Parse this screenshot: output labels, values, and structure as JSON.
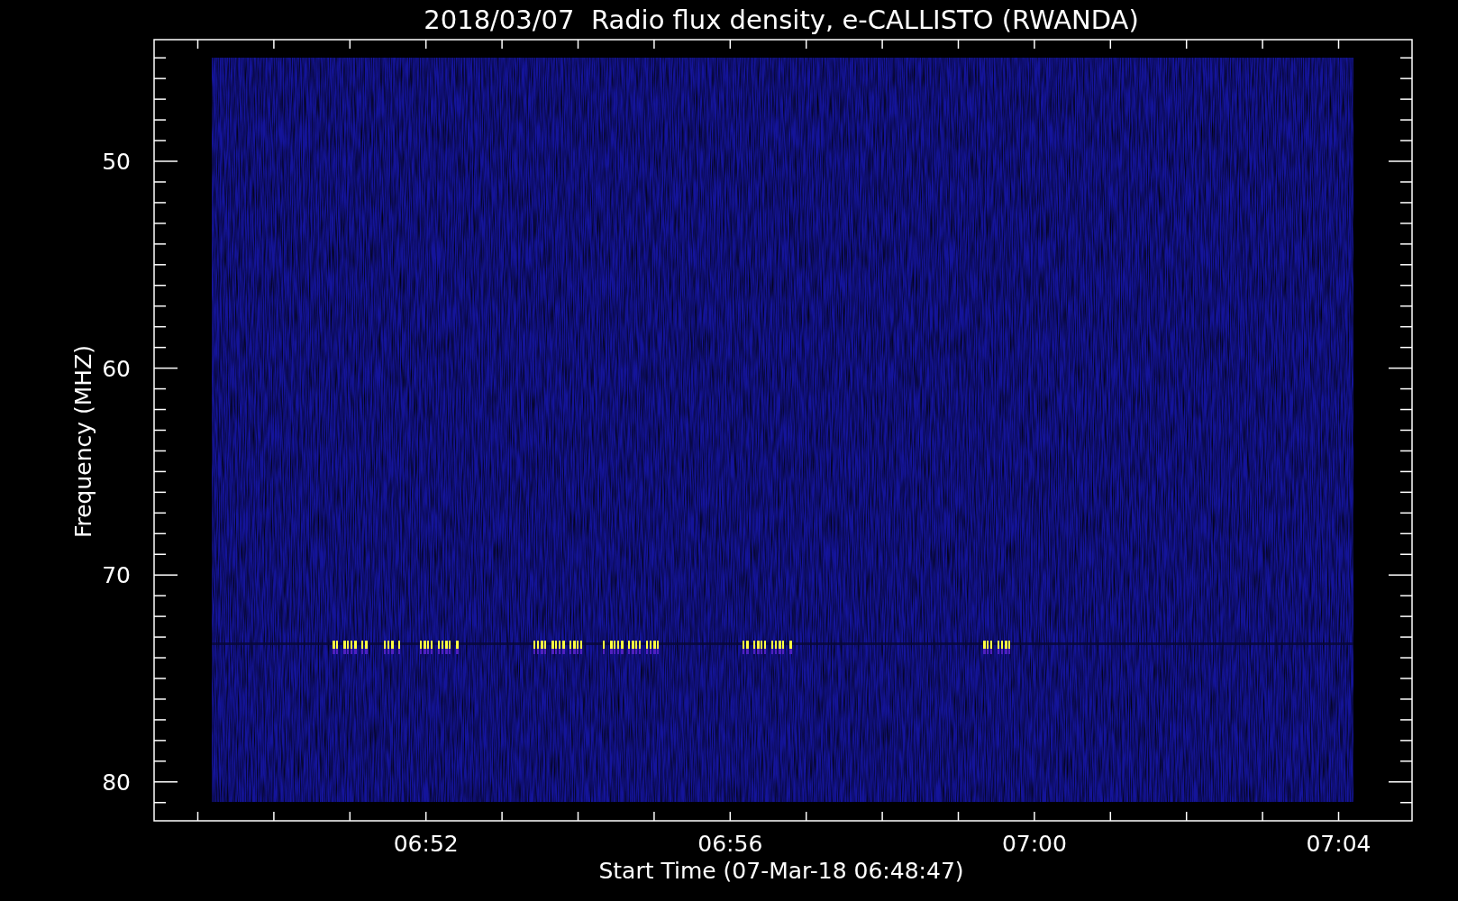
{
  "title": "2018/03/07  Radio flux density, e-CALLISTO (RWANDA)",
  "y_axis": {
    "label": "Frequency (MHZ)",
    "ticks": [
      "50",
      "60",
      "70",
      "80"
    ]
  },
  "x_axis": {
    "label": "Start Time (07-Mar-18 06:48:47)",
    "ticks": [
      "06:52",
      "06:56",
      "07:00",
      "07:04"
    ]
  }
}
